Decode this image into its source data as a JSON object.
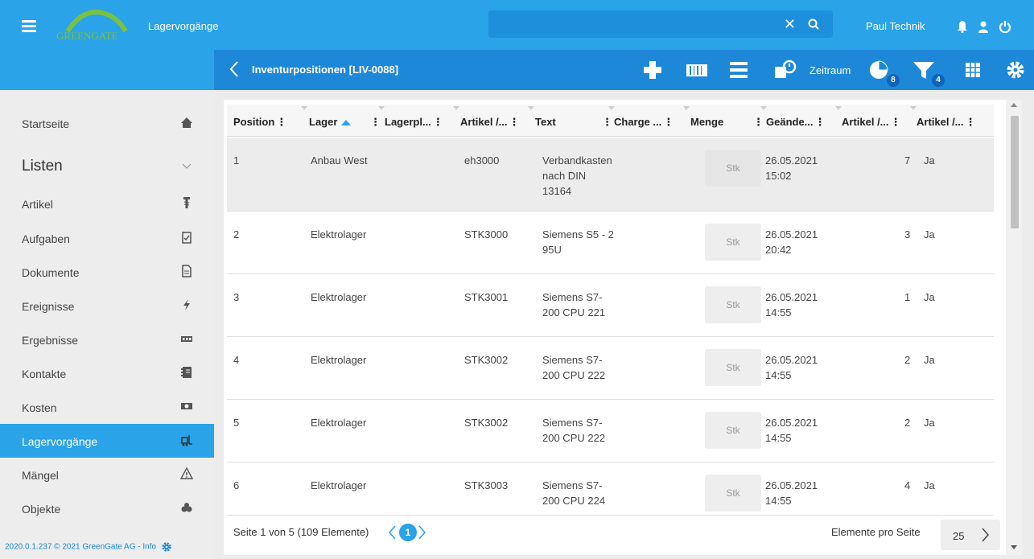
{
  "app": {
    "title": "Lagervorgänge",
    "logo_text": "GREENGATE"
  },
  "search": {
    "value": ""
  },
  "user": {
    "name": "Paul Technik"
  },
  "colors": {
    "primary": "#2aa3e8",
    "subbar": "#1e88d8",
    "active": "#2aa3e8"
  },
  "subbar": {
    "breadcrumb": "Inventurpositionen [LIV-0088]",
    "zeitraum": "Zeitraum",
    "chart_badge": "8",
    "filter_badge": "4"
  },
  "sidebar": {
    "items": [
      {
        "label": "Startseite",
        "icon": "home-icon"
      },
      {
        "label": "Listen",
        "icon": "chevron-down-icon"
      },
      {
        "label": "Artikel",
        "icon": "screw-icon"
      },
      {
        "label": "Aufgaben",
        "icon": "clipboard-icon"
      },
      {
        "label": "Dokumente",
        "icon": "document-icon"
      },
      {
        "label": "Ereignisse",
        "icon": "lightning-icon"
      },
      {
        "label": "Ergebnisse",
        "icon": "counter-icon"
      },
      {
        "label": "Kontakte",
        "icon": "address-book-icon"
      },
      {
        "label": "Kosten",
        "icon": "money-icon"
      },
      {
        "label": "Lagervorgänge",
        "icon": "forklift-icon"
      },
      {
        "label": "Mängel",
        "icon": "warning-icon"
      },
      {
        "label": "Objekte",
        "icon": "objects-icon"
      }
    ],
    "footer": "2020.0.1.237 © 2021 GreenGate AG - Info"
  },
  "table": {
    "columns": [
      "Position",
      "Lager",
      "Lagerpl...",
      "Artikel /...",
      "Text",
      "Charge ...",
      "Menge",
      "Geände...",
      "Artikel /...",
      "Artikel /..."
    ],
    "rows": [
      {
        "position": "1",
        "lager": "Anbau West",
        "artikel": "eh3000",
        "text": [
          "Verbandkasten",
          "nach DIN",
          "13164"
        ],
        "menge": "Stk",
        "date": "26.05.2021",
        "time": "15:02",
        "num": "7",
        "flag": "Ja"
      },
      {
        "position": "2",
        "lager": "Elektrolager",
        "artikel": "STK3000",
        "text": [
          "Siemens S5 - 2",
          "95U"
        ],
        "menge": "Stk",
        "date": "26.05.2021",
        "time": "20:42",
        "num": "3",
        "flag": "Ja"
      },
      {
        "position": "3",
        "lager": "Elektrolager",
        "artikel": "STK3001",
        "text": [
          "Siemens S7-",
          "200 CPU 221"
        ],
        "menge": "Stk",
        "date": "26.05.2021",
        "time": "14:55",
        "num": "1",
        "flag": "Ja"
      },
      {
        "position": "4",
        "lager": "Elektrolager",
        "artikel": "STK3002",
        "text": [
          "Siemens S7-",
          "200 CPU 222"
        ],
        "menge": "Stk",
        "date": "26.05.2021",
        "time": "14:55",
        "num": "2",
        "flag": "Ja"
      },
      {
        "position": "5",
        "lager": "Elektrolager",
        "artikel": "STK3002",
        "text": [
          "Siemens S7-",
          "200 CPU 222"
        ],
        "menge": "Stk",
        "date": "26.05.2021",
        "time": "14:55",
        "num": "2",
        "flag": "Ja"
      },
      {
        "position": "6",
        "lager": "Elektrolager",
        "artikel": "STK3003",
        "text": [
          "Siemens S7-",
          "200 CPU 224"
        ],
        "menge": "Stk",
        "date": "26.05.2021",
        "time": "14:55",
        "num": "4",
        "flag": "Ja"
      }
    ]
  },
  "pager": {
    "summary": "Seite 1 von 5 (109 Elemente)",
    "current_page": "1",
    "per_page_label": "Elemente pro Seite",
    "per_page_value": "25"
  }
}
